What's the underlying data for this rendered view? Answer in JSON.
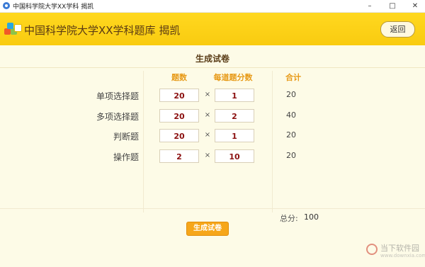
{
  "window": {
    "title": "中国科学院大学XX学科 揭凯",
    "minimize": "–",
    "maximize": "□",
    "close": "✕"
  },
  "header": {
    "title": "中国科学院大学XX学科题库 揭凯",
    "back_label": "返回",
    "logo_icon": "cubes-logo-icon"
  },
  "main": {
    "page_title": "生成试卷",
    "columns": {
      "count": "题数",
      "score": "每道题分数",
      "total": "合计"
    },
    "times_symbol": "×",
    "rows": [
      {
        "label": "单项选择题",
        "count": "20",
        "score": "1",
        "total": "20"
      },
      {
        "label": "多项选择题",
        "count": "20",
        "score": "2",
        "total": "40"
      },
      {
        "label": "判断题",
        "count": "20",
        "score": "1",
        "total": "20"
      },
      {
        "label": "操作题",
        "count": "2",
        "score": "10",
        "total": "20"
      }
    ],
    "total_label": "总分:",
    "total_value": "100",
    "generate_label": "生成试卷"
  },
  "watermark": {
    "text": "当下软件园",
    "sub": "www.downxia.com"
  },
  "colors": {
    "header_bg": "#ffd81f",
    "accent_orange": "#f6a61a",
    "column_header": "#e79a18",
    "input_value": "#8b1010",
    "page_bg": "#fdfbe7"
  }
}
